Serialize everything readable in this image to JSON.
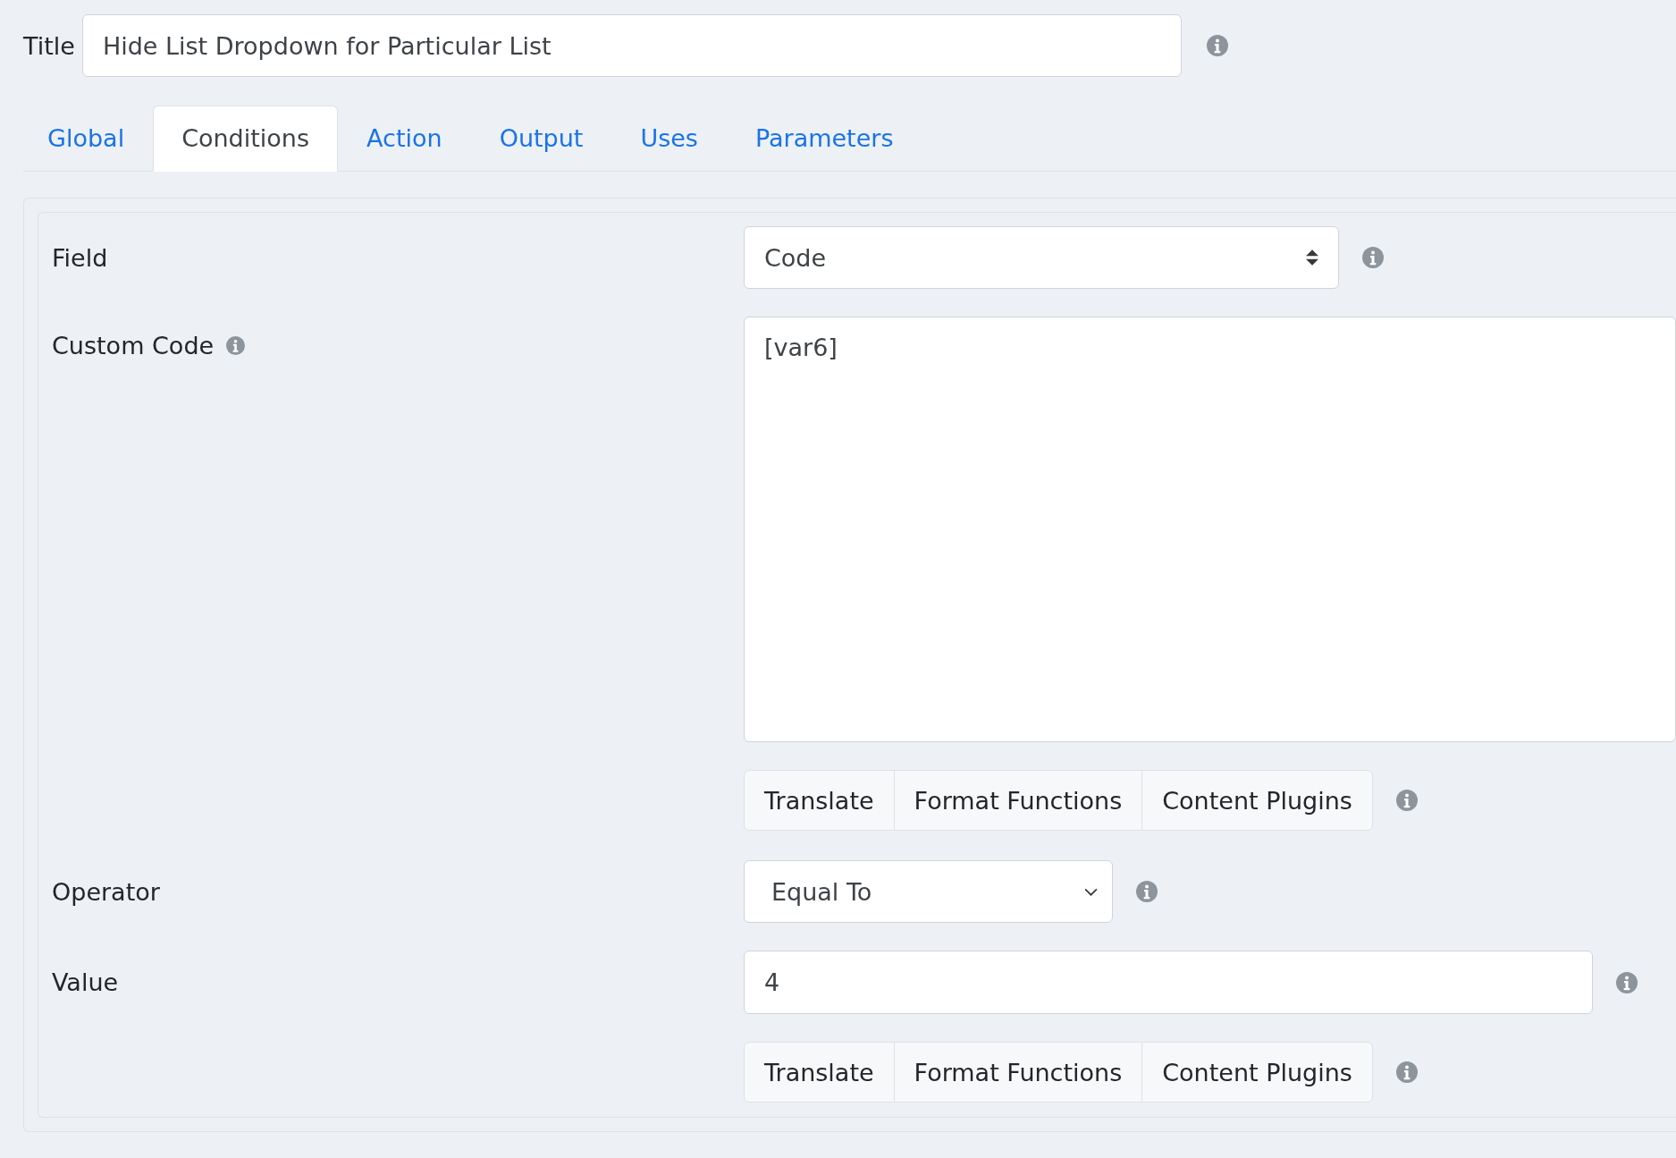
{
  "title": {
    "label": "Title",
    "value": "Hide List Dropdown for Particular List"
  },
  "tabs": [
    {
      "label": "Global",
      "selected": false
    },
    {
      "label": "Conditions",
      "selected": true
    },
    {
      "label": "Action",
      "selected": false
    },
    {
      "label": "Output",
      "selected": false
    },
    {
      "label": "Uses",
      "selected": false
    },
    {
      "label": "Parameters",
      "selected": false
    }
  ],
  "rows": [
    {
      "kind": "custom-select",
      "label": "Field",
      "value": "Code"
    },
    {
      "kind": "textarea",
      "label": "Custom Code",
      "label_info": true,
      "value": "[var6]"
    },
    {
      "kind": "buttons",
      "buttons": [
        "Translate",
        "Format Functions",
        "Content Plugins"
      ]
    },
    {
      "kind": "select",
      "label": "Operator",
      "value": "Equal To"
    },
    {
      "kind": "text",
      "label": "Value",
      "value": "4"
    },
    {
      "kind": "buttons",
      "buttons": [
        "Translate",
        "Format Functions",
        "Content Plugins"
      ]
    }
  ]
}
